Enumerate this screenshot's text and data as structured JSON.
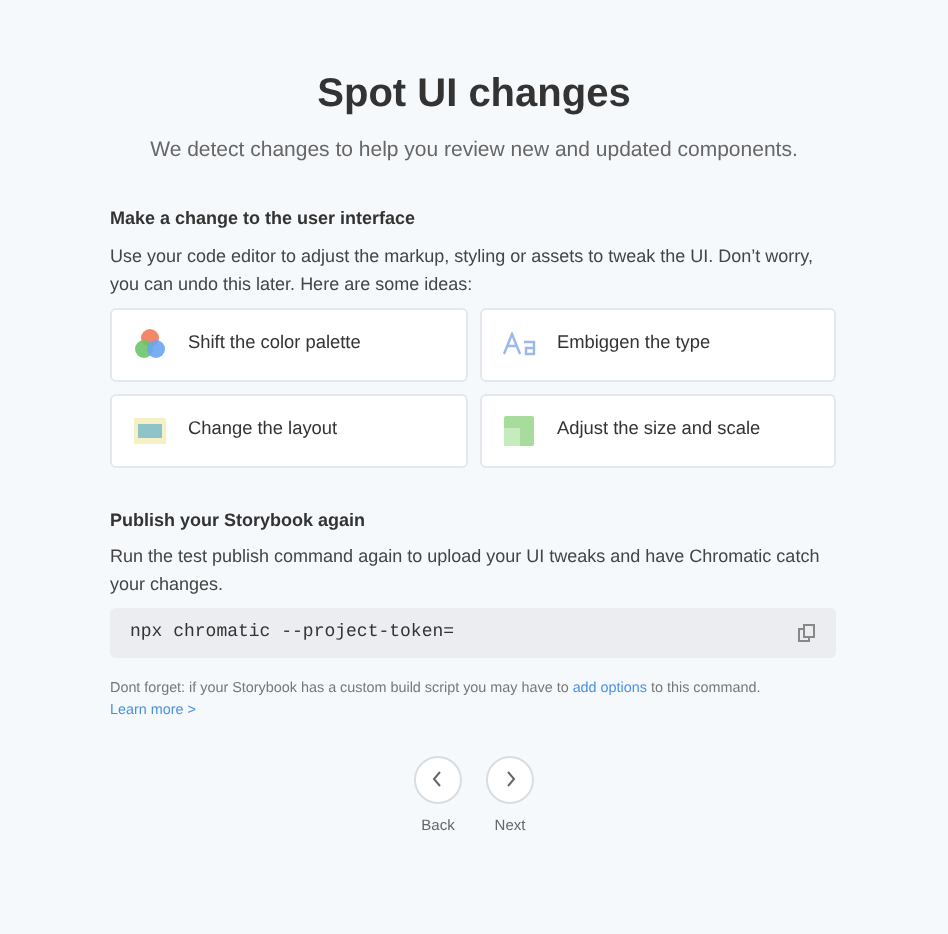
{
  "title": "Spot UI changes",
  "subtitle": "We detect changes to help you review new and updated components.",
  "section_1": {
    "heading": "Make a change to the user interface",
    "body": "Use your code editor to adjust the markup, styling or assets to tweak the UI. Don’t worry, you can undo this later. Here are some ideas:",
    "ideas": [
      {
        "kind": "palette",
        "label": "Shift the color palette"
      },
      {
        "kind": "type",
        "label": "Embiggen the type"
      },
      {
        "kind": "layout",
        "label": "Change the layout"
      },
      {
        "kind": "scale",
        "label": "Adjust the size and scale"
      }
    ]
  },
  "section_2": {
    "heading": "Publish your Storybook again",
    "body": "Run the test publish command again to upload your UI tweaks and have Chromatic catch your changes.",
    "command": "npx chromatic --project-token=",
    "note": {
      "before": "Dont forget: if your Storybook has a custom build script you may have to ",
      "link": "add options",
      "after": " to this command."
    },
    "learn_more": "Learn more >"
  },
  "nav": [
    {
      "kind": "back",
      "label": "Back"
    },
    {
      "kind": "next",
      "label": "Next"
    }
  ]
}
